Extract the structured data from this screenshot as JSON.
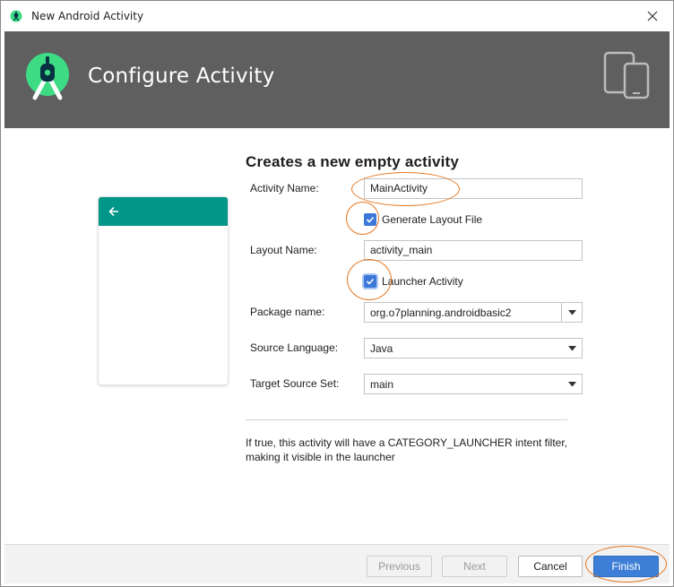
{
  "window": {
    "title": "New Android Activity",
    "close_icon": "close-icon"
  },
  "header": {
    "title": "Configure Activity",
    "logo_icon": "android-studio-logo",
    "device_icon": "tablet-phone-icon",
    "background_color": "#5f5f5f"
  },
  "preview": {
    "toolbar_color": "#009688",
    "back_icon": "arrow-back-icon"
  },
  "form": {
    "heading": "Creates a new empty activity",
    "activity_name_label": "Activity Name:",
    "activity_name_value": "MainActivity",
    "generate_layout_label": "Generate Layout File",
    "generate_layout_checked": true,
    "layout_name_label": "Layout Name:",
    "layout_name_value": "activity_main",
    "launcher_activity_label": "Launcher Activity",
    "launcher_activity_checked": true,
    "package_name_label": "Package name:",
    "package_name_value": "org.o7planning.androidbasic2",
    "source_language_label": "Source Language:",
    "source_language_value": "Java",
    "target_source_set_label": "Target Source Set:",
    "target_source_set_value": "main",
    "help_text": "If true, this activity will have a CATEGORY_LAUNCHER intent filter, making it visible in the launcher"
  },
  "footer": {
    "previous_label": "Previous",
    "next_label": "Next",
    "cancel_label": "Cancel",
    "finish_label": "Finish"
  },
  "colors": {
    "accent": "#3d7ed6",
    "annotation": "#e5761e"
  }
}
